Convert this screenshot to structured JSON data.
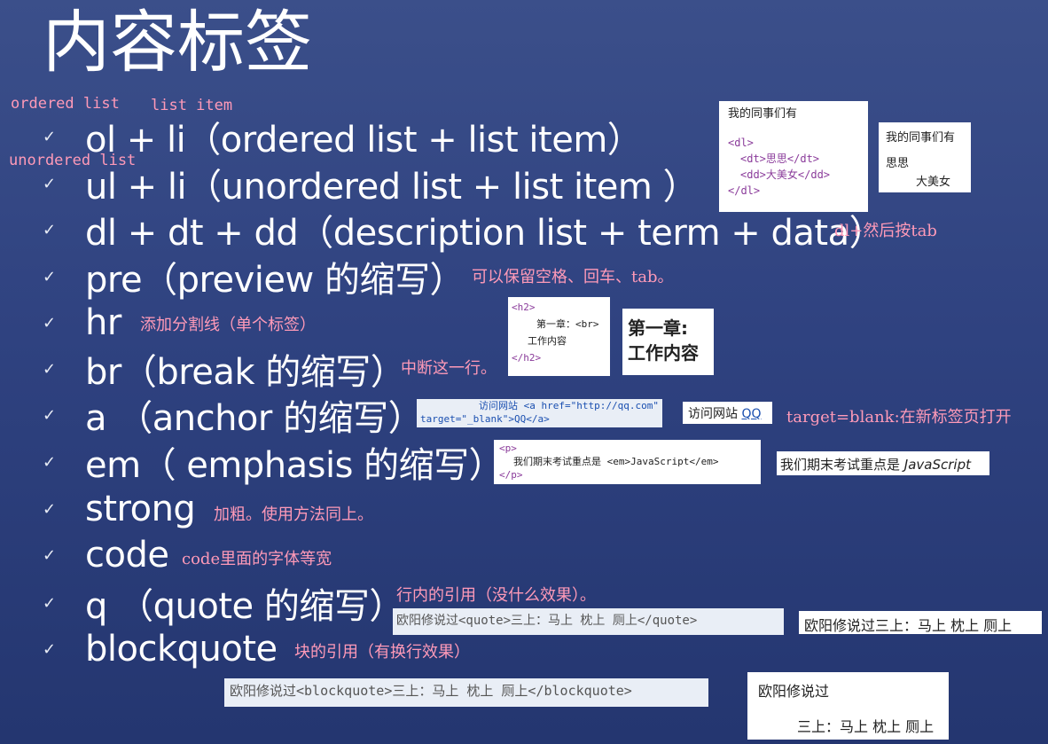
{
  "title": "内容标签",
  "side_notes": {
    "ordered_list": "ordered list",
    "list_item": "list item",
    "unordered_list": "unordered list"
  },
  "items": [
    {
      "text": "ol + li（ordered list + list item）"
    },
    {
      "text": "ul + li（unordered list + list item ）"
    },
    {
      "text": "dl + dt + dd（description list + term + data）"
    },
    {
      "text": "pre（preview 的缩写）"
    },
    {
      "text": "hr"
    },
    {
      "text": "br（break 的缩写）"
    },
    {
      "text": "a （anchor 的缩写）"
    },
    {
      "text": "em（ emphasis 的缩写）"
    },
    {
      "text": "strong"
    },
    {
      "text": "code"
    },
    {
      "text": "q （quote 的缩写）"
    },
    {
      "text": "blockquote"
    }
  ],
  "check_glyph": "✓",
  "notes": {
    "dl": "dl+然后按tab",
    "pre": "可以保留空格、回车、tab。",
    "hr": "添加分割线（单个标签）",
    "br": "中断这一行。",
    "a": "target=blank:在新标签页打开",
    "strong": "加粗。使用方法同上。",
    "code": "code里面的字体等宽",
    "q": "行内的引用（没什么效果）。",
    "blockquote": "块的引用（有换行效果）"
  },
  "dl_example": {
    "code_title": "我的同事们有",
    "code_lines": [
      "<dl>",
      "<dt>思思</dt>",
      "<dd>大美女</dd>",
      "</dl>"
    ],
    "render_title": "我的同事们有",
    "render_term": "思思",
    "render_data": "大美女"
  },
  "br_example": {
    "code_lines": [
      "<h2>",
      "第一章：<br>",
      "工作内容",
      "</h2>"
    ],
    "render_line1": "第一章:",
    "render_line2": "工作内容"
  },
  "a_example": {
    "code_line1": "访问网站 <a href=\"http://qq.com\"",
    "code_line2": "target=\"_blank\">QQ</a>",
    "render_text": "访问网站 ",
    "render_link": "QQ"
  },
  "em_example": {
    "code_lines": [
      "<p>",
      "我们期末考试重点是 <em>JavaScript</em>",
      "</p>"
    ],
    "render_text": "我们期末考试重点是 ",
    "render_em": "JavaScript"
  },
  "q_example": {
    "code": "欧阳修说过<quote>三上：马上 枕上 厕上</quote>",
    "render": "欧阳修说过三上：马上 枕上 厕上"
  },
  "blockquote_example": {
    "code": "欧阳修说过<blockquote>三上：马上 枕上 厕上</blockquote>",
    "render_line1": "欧阳修说过",
    "render_line2": "三上：马上 枕上 厕上"
  }
}
